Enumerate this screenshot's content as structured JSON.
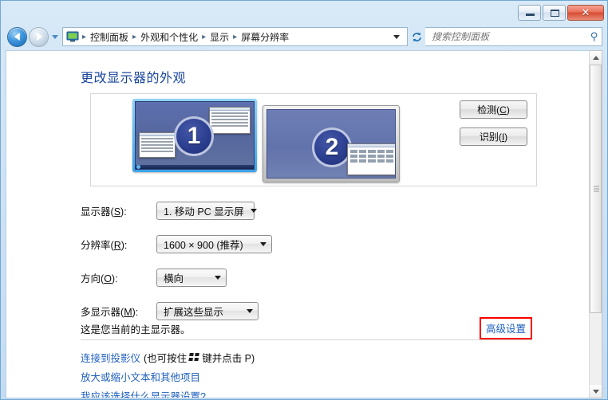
{
  "window": {
    "buttons": {
      "minimize": "—",
      "maximize": "□",
      "close": "✕"
    }
  },
  "nav": {
    "back_label": "后退",
    "forward_label": "前进",
    "history_label": "最近浏览的位置",
    "refresh_label": "刷新",
    "breadcrumb": [
      "控制面板",
      "外观和个性化",
      "显示",
      "屏幕分辨率"
    ],
    "separator": "▸"
  },
  "search": {
    "placeholder": "搜索控制面板",
    "value": "",
    "icon": "search-icon"
  },
  "main": {
    "page_title": "更改显示器的外观",
    "preview": {
      "monitors": [
        {
          "number": "1",
          "selected": true
        },
        {
          "number": "2",
          "selected": false
        }
      ]
    },
    "side_buttons": [
      {
        "label": "检测",
        "accesskey": "C"
      },
      {
        "label": "识别",
        "accesskey": "I"
      }
    ],
    "form_rows": [
      {
        "label": "显示器",
        "accesskey": "S",
        "value": "1. 移动 PC 显示屏"
      },
      {
        "label": "分辨率",
        "accesskey": "R",
        "value": "1600 × 900 (推荐)"
      },
      {
        "label": "方向",
        "accesskey": "O",
        "value": "横向"
      },
      {
        "label": "多显示器",
        "accesskey": "M",
        "value": "扩展这些显示"
      }
    ],
    "status_text": "这是您当前的主显示器。",
    "advanced_link": "高级设置",
    "links": {
      "projector_prefix": "连接到投影仪",
      "projector_hint_open": "(也可按住",
      "projector_hint_close": "键并点击 P)",
      "text_size": "放大或缩小文本和其他项目",
      "help": "我应该选择什么显示器设置?"
    }
  },
  "annotation": {
    "highlight_color": "#ff0000",
    "target": "高级设置"
  },
  "colors": {
    "accent": "#19459d",
    "link": "#1f5fbf",
    "frame": "#c4dcf2",
    "monitor_selected_border": "#3ba3e8"
  }
}
